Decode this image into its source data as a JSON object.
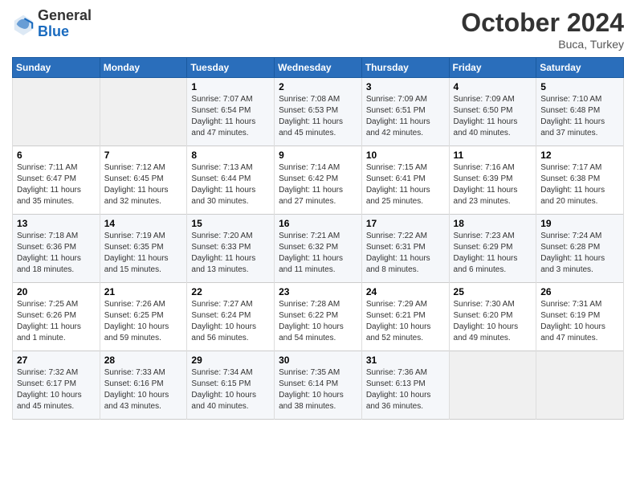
{
  "logo": {
    "general": "General",
    "blue": "Blue"
  },
  "header": {
    "month": "October 2024",
    "location": "Buca, Turkey"
  },
  "weekdays": [
    "Sunday",
    "Monday",
    "Tuesday",
    "Wednesday",
    "Thursday",
    "Friday",
    "Saturday"
  ],
  "weeks": [
    [
      {
        "day": "",
        "info": ""
      },
      {
        "day": "",
        "info": ""
      },
      {
        "day": "1",
        "info": "Sunrise: 7:07 AM\nSunset: 6:54 PM\nDaylight: 11 hours and 47 minutes."
      },
      {
        "day": "2",
        "info": "Sunrise: 7:08 AM\nSunset: 6:53 PM\nDaylight: 11 hours and 45 minutes."
      },
      {
        "day": "3",
        "info": "Sunrise: 7:09 AM\nSunset: 6:51 PM\nDaylight: 11 hours and 42 minutes."
      },
      {
        "day": "4",
        "info": "Sunrise: 7:09 AM\nSunset: 6:50 PM\nDaylight: 11 hours and 40 minutes."
      },
      {
        "day": "5",
        "info": "Sunrise: 7:10 AM\nSunset: 6:48 PM\nDaylight: 11 hours and 37 minutes."
      }
    ],
    [
      {
        "day": "6",
        "info": "Sunrise: 7:11 AM\nSunset: 6:47 PM\nDaylight: 11 hours and 35 minutes."
      },
      {
        "day": "7",
        "info": "Sunrise: 7:12 AM\nSunset: 6:45 PM\nDaylight: 11 hours and 32 minutes."
      },
      {
        "day": "8",
        "info": "Sunrise: 7:13 AM\nSunset: 6:44 PM\nDaylight: 11 hours and 30 minutes."
      },
      {
        "day": "9",
        "info": "Sunrise: 7:14 AM\nSunset: 6:42 PM\nDaylight: 11 hours and 27 minutes."
      },
      {
        "day": "10",
        "info": "Sunrise: 7:15 AM\nSunset: 6:41 PM\nDaylight: 11 hours and 25 minutes."
      },
      {
        "day": "11",
        "info": "Sunrise: 7:16 AM\nSunset: 6:39 PM\nDaylight: 11 hours and 23 minutes."
      },
      {
        "day": "12",
        "info": "Sunrise: 7:17 AM\nSunset: 6:38 PM\nDaylight: 11 hours and 20 minutes."
      }
    ],
    [
      {
        "day": "13",
        "info": "Sunrise: 7:18 AM\nSunset: 6:36 PM\nDaylight: 11 hours and 18 minutes."
      },
      {
        "day": "14",
        "info": "Sunrise: 7:19 AM\nSunset: 6:35 PM\nDaylight: 11 hours and 15 minutes."
      },
      {
        "day": "15",
        "info": "Sunrise: 7:20 AM\nSunset: 6:33 PM\nDaylight: 11 hours and 13 minutes."
      },
      {
        "day": "16",
        "info": "Sunrise: 7:21 AM\nSunset: 6:32 PM\nDaylight: 11 hours and 11 minutes."
      },
      {
        "day": "17",
        "info": "Sunrise: 7:22 AM\nSunset: 6:31 PM\nDaylight: 11 hours and 8 minutes."
      },
      {
        "day": "18",
        "info": "Sunrise: 7:23 AM\nSunset: 6:29 PM\nDaylight: 11 hours and 6 minutes."
      },
      {
        "day": "19",
        "info": "Sunrise: 7:24 AM\nSunset: 6:28 PM\nDaylight: 11 hours and 3 minutes."
      }
    ],
    [
      {
        "day": "20",
        "info": "Sunrise: 7:25 AM\nSunset: 6:26 PM\nDaylight: 11 hours and 1 minute."
      },
      {
        "day": "21",
        "info": "Sunrise: 7:26 AM\nSunset: 6:25 PM\nDaylight: 10 hours and 59 minutes."
      },
      {
        "day": "22",
        "info": "Sunrise: 7:27 AM\nSunset: 6:24 PM\nDaylight: 10 hours and 56 minutes."
      },
      {
        "day": "23",
        "info": "Sunrise: 7:28 AM\nSunset: 6:22 PM\nDaylight: 10 hours and 54 minutes."
      },
      {
        "day": "24",
        "info": "Sunrise: 7:29 AM\nSunset: 6:21 PM\nDaylight: 10 hours and 52 minutes."
      },
      {
        "day": "25",
        "info": "Sunrise: 7:30 AM\nSunset: 6:20 PM\nDaylight: 10 hours and 49 minutes."
      },
      {
        "day": "26",
        "info": "Sunrise: 7:31 AM\nSunset: 6:19 PM\nDaylight: 10 hours and 47 minutes."
      }
    ],
    [
      {
        "day": "27",
        "info": "Sunrise: 7:32 AM\nSunset: 6:17 PM\nDaylight: 10 hours and 45 minutes."
      },
      {
        "day": "28",
        "info": "Sunrise: 7:33 AM\nSunset: 6:16 PM\nDaylight: 10 hours and 43 minutes."
      },
      {
        "day": "29",
        "info": "Sunrise: 7:34 AM\nSunset: 6:15 PM\nDaylight: 10 hours and 40 minutes."
      },
      {
        "day": "30",
        "info": "Sunrise: 7:35 AM\nSunset: 6:14 PM\nDaylight: 10 hours and 38 minutes."
      },
      {
        "day": "31",
        "info": "Sunrise: 7:36 AM\nSunset: 6:13 PM\nDaylight: 10 hours and 36 minutes."
      },
      {
        "day": "",
        "info": ""
      },
      {
        "day": "",
        "info": ""
      }
    ]
  ]
}
